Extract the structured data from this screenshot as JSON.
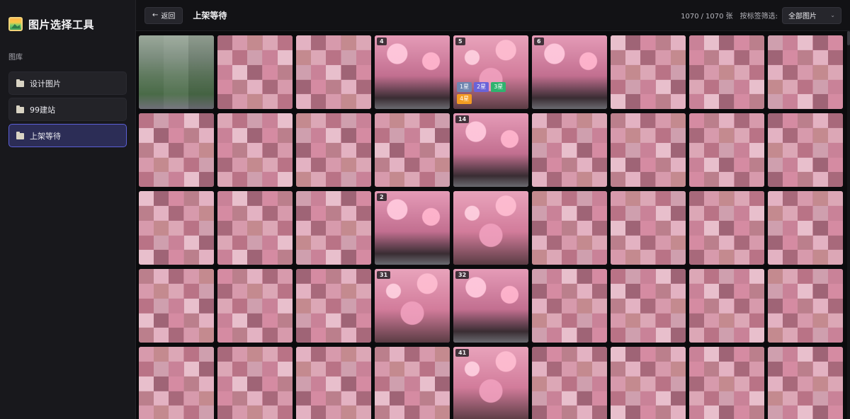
{
  "app": {
    "title": "图片选择工具"
  },
  "sidebar": {
    "section_label": "图库",
    "items": [
      {
        "label": "设计图片",
        "icon": "folder-icon",
        "active": false
      },
      {
        "label": "99建站",
        "icon": "folder-icon",
        "active": false
      },
      {
        "label": "上架等待",
        "icon": "folder-icon",
        "active": true
      }
    ]
  },
  "header": {
    "back_label": "返回",
    "back_icon": "arrow-left-icon",
    "title": "上架等待",
    "count_shown": "1070",
    "count_total": "1070",
    "count_unit": "张",
    "filter_label": "按标签筛选:",
    "filter_value": "全部图片"
  },
  "colors": {
    "accent": "#5b5fd6",
    "active_nav_bg": "#2c2d56",
    "tag_1": "#6f86b0",
    "tag_2": "#6a63d8",
    "tag_3": "#2fb36f",
    "tag_4": "#f39c22"
  },
  "grid": {
    "tiles": [
      {
        "kind": "green"
      },
      {
        "kind": "pix"
      },
      {
        "kind": "pix"
      },
      {
        "kind": "photo",
        "number": "4"
      },
      {
        "kind": "photo",
        "number": "5",
        "tags": [
          "1星",
          "2星",
          "3星",
          "4星"
        ]
      },
      {
        "kind": "photo",
        "number": "6"
      },
      {
        "kind": "pix"
      },
      {
        "kind": "pix"
      },
      {
        "kind": "pix"
      },
      {
        "kind": "pix"
      },
      {
        "kind": "pix"
      },
      {
        "kind": "pix"
      },
      {
        "kind": "pix"
      },
      {
        "kind": "photo",
        "number": "14"
      },
      {
        "kind": "pix"
      },
      {
        "kind": "pix"
      },
      {
        "kind": "pix"
      },
      {
        "kind": "pix"
      },
      {
        "kind": "pix"
      },
      {
        "kind": "pix"
      },
      {
        "kind": "pix"
      },
      {
        "kind": "photo",
        "number": "2"
      },
      {
        "kind": "photo"
      },
      {
        "kind": "pix"
      },
      {
        "kind": "pix"
      },
      {
        "kind": "pix"
      },
      {
        "kind": "pix"
      },
      {
        "kind": "pix"
      },
      {
        "kind": "pix"
      },
      {
        "kind": "pix"
      },
      {
        "kind": "photo",
        "number": "31"
      },
      {
        "kind": "photo",
        "number": "32"
      },
      {
        "kind": "pix"
      },
      {
        "kind": "pix"
      },
      {
        "kind": "pix"
      },
      {
        "kind": "pix"
      },
      {
        "kind": "pix"
      },
      {
        "kind": "pix"
      },
      {
        "kind": "pix"
      },
      {
        "kind": "pix"
      },
      {
        "kind": "photo",
        "number": "41"
      },
      {
        "kind": "pix"
      },
      {
        "kind": "pix"
      },
      {
        "kind": "pix"
      },
      {
        "kind": "pix"
      }
    ]
  }
}
